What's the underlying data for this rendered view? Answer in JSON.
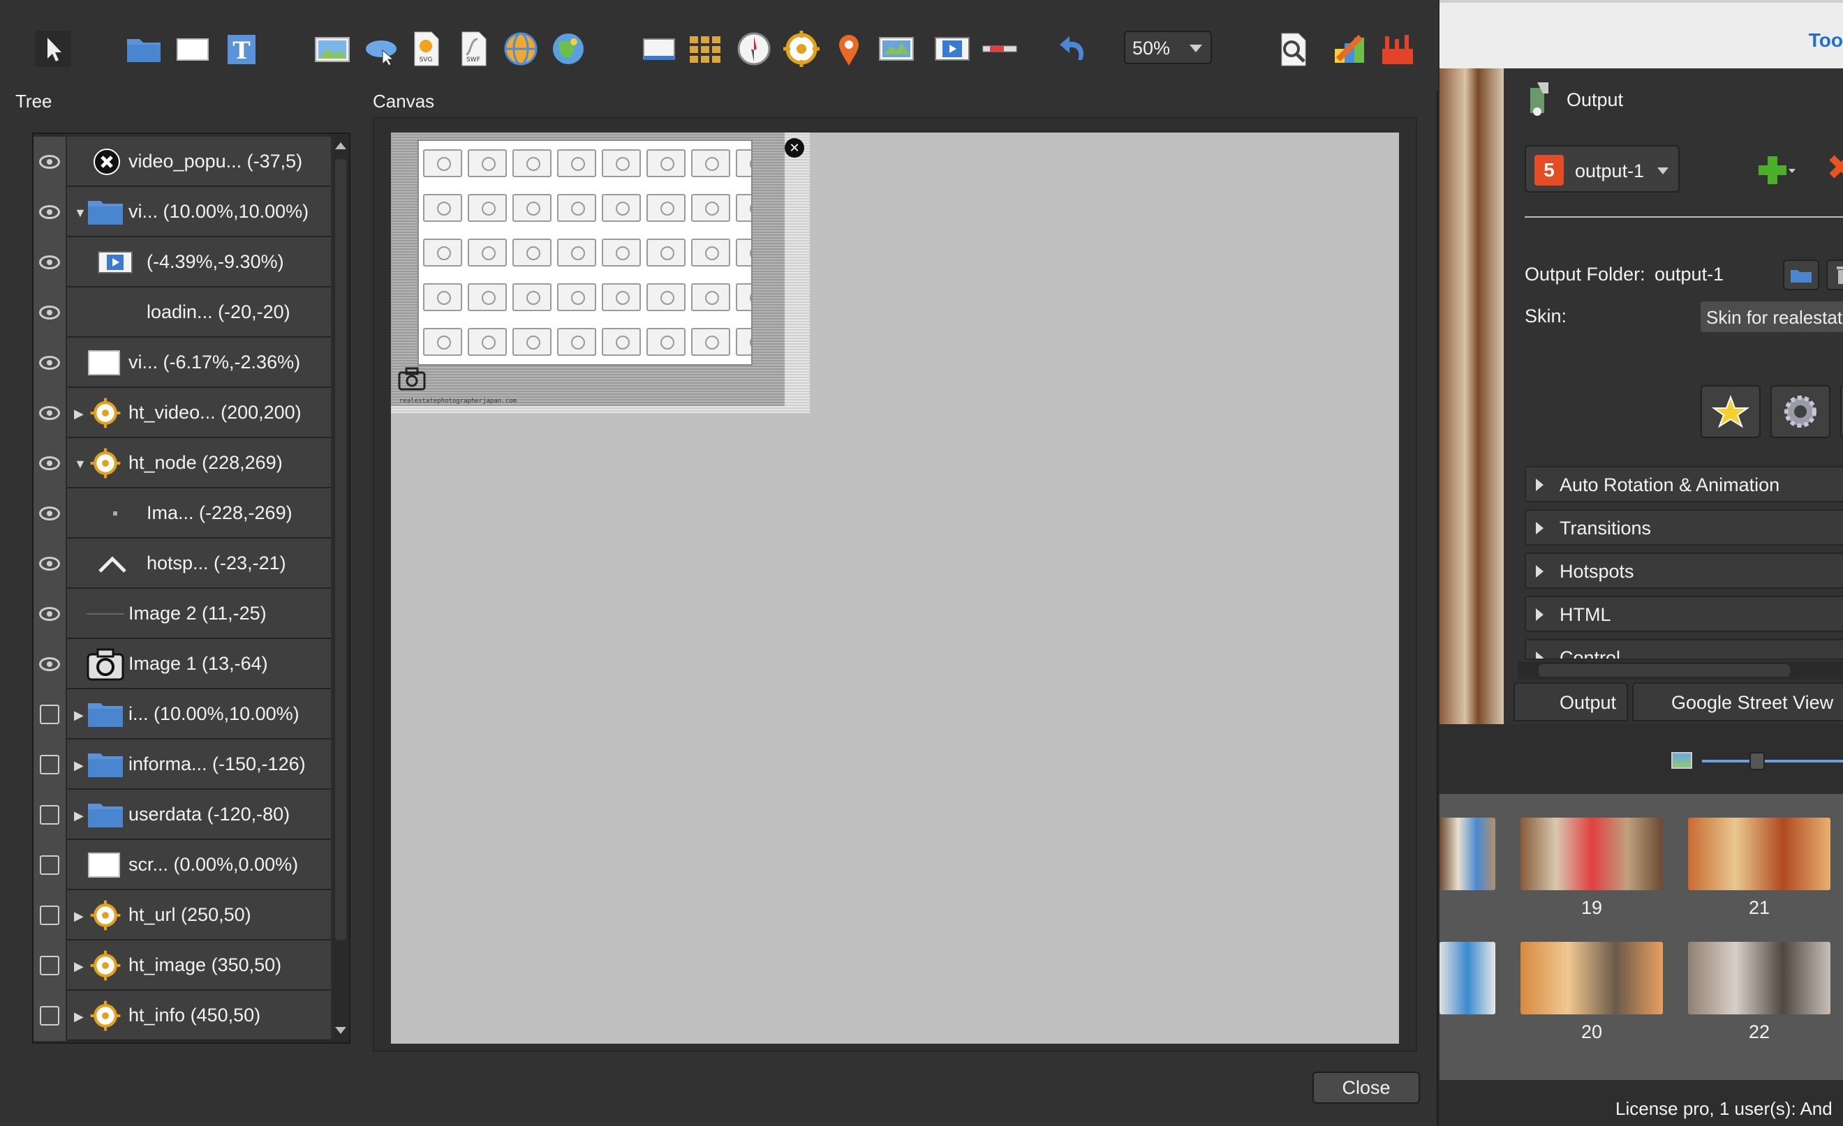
{
  "toolbar": {
    "zoom_value": "50%",
    "icons": [
      "pointer-icon",
      "folder-icon",
      "rectangle-icon",
      "text-icon",
      "image-icon",
      "cloud-icon",
      "svg-icon",
      "swf-icon",
      "globe-icon",
      "map-icon",
      "video-icon",
      "grid-icon",
      "compass-icon",
      "hotspot-icon",
      "pin-icon",
      "map-image-icon",
      "film-icon",
      "scrollbar-icon",
      "undo-icon",
      "zoom-search-icon",
      "color-palette-icon",
      "tools-icon"
    ]
  },
  "tree": {
    "title": "Tree",
    "rows": [
      {
        "label": "video_popu... (-37,5)",
        "visible": true,
        "icon": "close-circle-icon",
        "expandable": false
      },
      {
        "label": "vi... (10.00%,10.00%)",
        "visible": true,
        "icon": "folder-icon",
        "expandable": true,
        "expanded": true
      },
      {
        "label": "(-4.39%,-9.30%)",
        "visible": true,
        "icon": "video-icon",
        "expandable": false
      },
      {
        "label": "loadin... (-20,-20)",
        "visible": true,
        "icon": "",
        "expandable": false
      },
      {
        "label": "vi... (-6.17%,-2.36%)",
        "visible": true,
        "icon": "rectangle-icon",
        "expandable": false
      },
      {
        "label": "ht_video... (200,200)",
        "visible": true,
        "icon": "hotspot-icon",
        "expandable": true
      },
      {
        "label": "ht_node (228,269)",
        "visible": true,
        "icon": "hotspot-icon",
        "expandable": true,
        "expanded": true
      },
      {
        "label": "Ima... (-228,-269)",
        "visible": true,
        "icon": "dot-icon",
        "expandable": false
      },
      {
        "label": "hotsp... (-23,-21)",
        "visible": true,
        "icon": "chevron-up-icon",
        "expandable": false
      },
      {
        "label": "Image 2 (11,-25)",
        "visible": true,
        "icon": "line-icon",
        "expandable": false
      },
      {
        "label": "Image 1 (13,-64)",
        "visible": true,
        "icon": "camera-icon",
        "expandable": false
      },
      {
        "label": "i... (10.00%,10.00%)",
        "visible": false,
        "icon": "folder-icon",
        "expandable": true
      },
      {
        "label": "informa... (-150,-126)",
        "visible": false,
        "icon": "folder-icon",
        "expandable": true
      },
      {
        "label": "userdata (-120,-80)",
        "visible": false,
        "icon": "folder-icon",
        "expandable": true
      },
      {
        "label": "scr... (0.00%,0.00%)",
        "visible": false,
        "icon": "rectangle-icon",
        "expandable": false
      },
      {
        "label": "ht_url (250,50)",
        "visible": false,
        "icon": "hotspot-icon",
        "expandable": true
      },
      {
        "label": "ht_image (350,50)",
        "visible": false,
        "icon": "hotspot-icon",
        "expandable": true
      },
      {
        "label": "ht_info (450,50)",
        "visible": false,
        "icon": "hotspot-icon",
        "expandable": true
      }
    ]
  },
  "canvas": {
    "title": "Canvas",
    "watermark": "realestatephotographerjapan.com"
  },
  "footer": {
    "close_label": "Close"
  },
  "right_app": {
    "header_tools": "Too",
    "output_title": "Output",
    "output_select": "output-1",
    "output_folder_label": "Output Folder:",
    "output_folder_value": "output-1",
    "skin_label": "Skin:",
    "skin_value": "Skin for realestatepho",
    "accordions": [
      "Auto Rotation & Animation",
      "Transitions",
      "Hotspots",
      "HTML",
      "Control"
    ],
    "tabs": [
      "Output",
      "Google Street View"
    ],
    "thumbnails": [
      "19",
      "21",
      "20",
      "22"
    ],
    "license": "License pro, 1 user(s): And"
  },
  "colors": {
    "accent_blue": "#1f6fd1",
    "html5_orange": "#e44d26",
    "add_green": "#4caf2a",
    "remove_red": "#e8541f"
  }
}
